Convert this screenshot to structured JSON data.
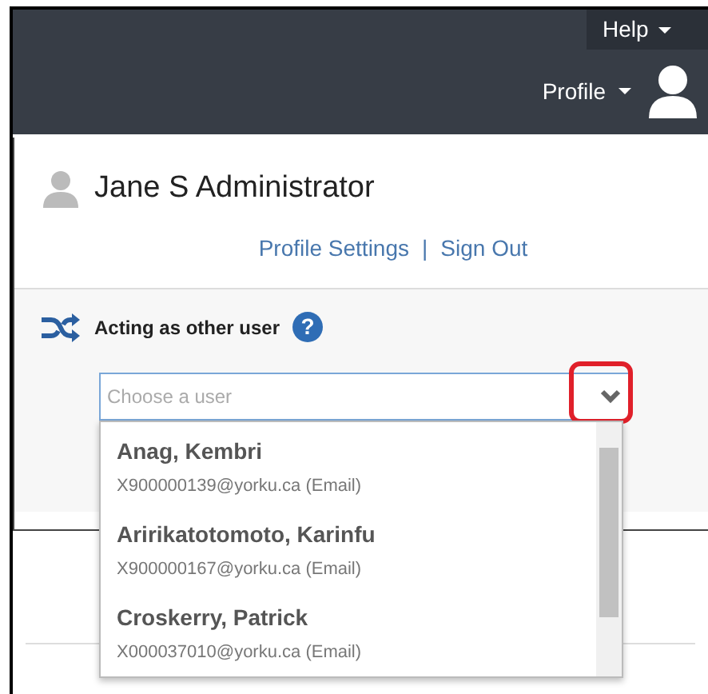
{
  "topbar": {
    "help_label": "Help",
    "profile_label": "Profile"
  },
  "user": {
    "name": "Jane S Administrator",
    "links": [
      "Profile Settings",
      "Sign Out"
    ],
    "link_separator": "|"
  },
  "acting": {
    "label": "Acting as other user",
    "help_glyph": "?"
  },
  "select": {
    "placeholder": "Choose a user",
    "expanded": true,
    "highlighted": true
  },
  "options": [
    {
      "name": "Anag, Kembri",
      "email": "X900000139@yorku.ca (Email)"
    },
    {
      "name": "Aririkatotomoto, Karinfu",
      "email": "X900000167@yorku.ca (Email)"
    },
    {
      "name": "Croskerry, Patrick",
      "email": "X000037010@yorku.ca (Email)"
    }
  ]
}
